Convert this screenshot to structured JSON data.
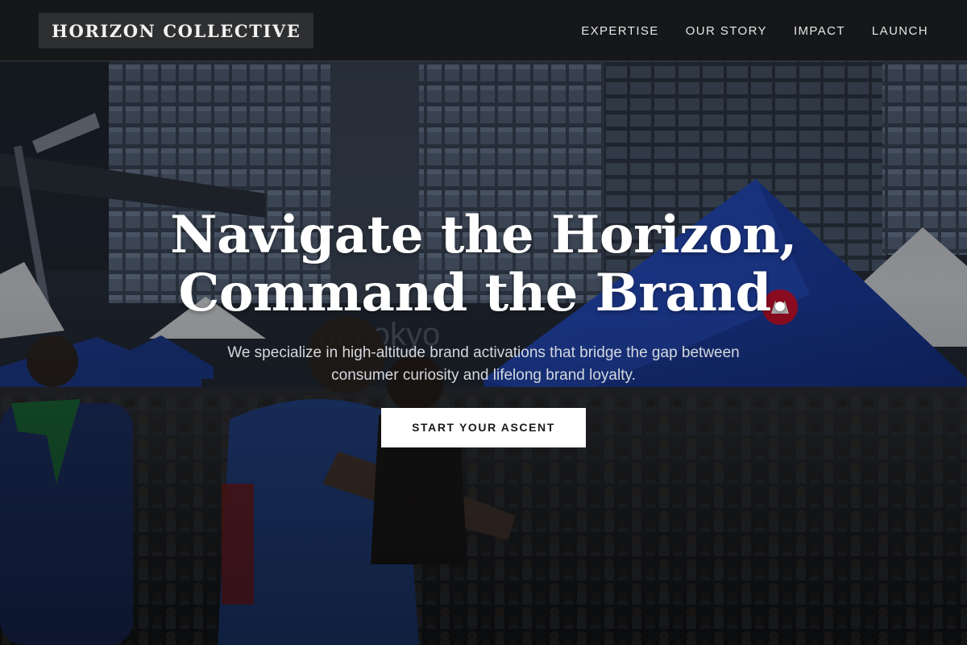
{
  "header": {
    "brand": "HORIZON COLLECTIVE",
    "nav": [
      {
        "label": "EXPERTISE"
      },
      {
        "label": "OUR STORY"
      },
      {
        "label": "IMPACT"
      },
      {
        "label": "LAUNCH"
      }
    ]
  },
  "hero": {
    "title_line_1": "Navigate the Horizon,",
    "title_line_2": "Command the Brand.",
    "subtitle": "We specialize in high-altitude brand activations that bridge the gap between consumer curiosity and lifelong brand loyalty.",
    "cta_label": "START YOUR ASCENT",
    "background": {
      "tent_banner_text": "BMO",
      "sign_text": "pat  okyo"
    }
  },
  "colors": {
    "header_bg": "#161719",
    "logo_bg": "#2e2f31",
    "nav_text": "#e6e6e6",
    "title_text": "#ffffff",
    "subtitle_text": "#d4d8de",
    "cta_bg": "#ffffff",
    "cta_text": "#1a1a1a",
    "tent_blue": "#1b3d9c",
    "bmo_red": "#c8102e"
  }
}
